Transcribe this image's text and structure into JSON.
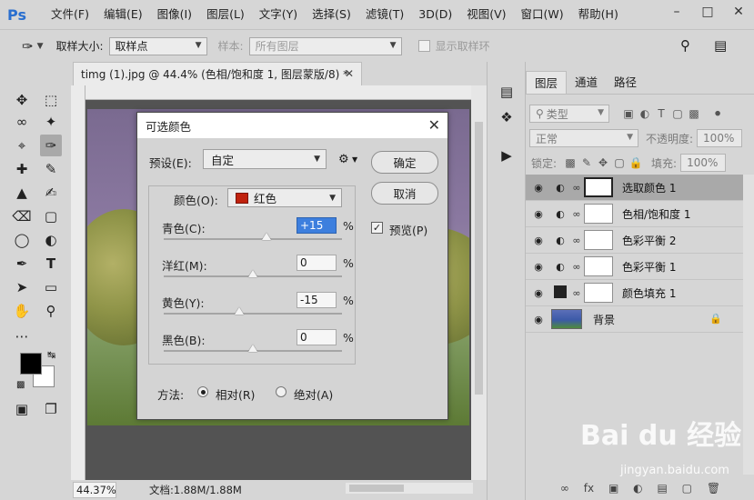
{
  "app": {
    "logo": "Ps"
  },
  "menu": [
    "文件(F)",
    "编辑(E)",
    "图像(I)",
    "图层(L)",
    "文字(Y)",
    "选择(S)",
    "滤镜(T)",
    "3D(D)",
    "视图(V)",
    "窗口(W)",
    "帮助(H)"
  ],
  "options": {
    "sample_size_label": "取样大小:",
    "sample_size_value": "取样点",
    "sample_label": "样本:",
    "sample_value": "所有图层",
    "show_ring_label": "显示取样环"
  },
  "document": {
    "tab_title": "timg (1).jpg @ 44.4% (色相/饱和度 1, 图层蒙版/8) *",
    "zoom": "44.37%",
    "doc_info": "文档:1.88M/1.88M"
  },
  "layers_panel": {
    "tabs": [
      "图层",
      "通道",
      "路径"
    ],
    "filter_type": "类型",
    "blend_mode": "正常",
    "opacity_label": "不透明度:",
    "opacity_value": "100%",
    "lock_label": "锁定:",
    "fill_label": "填充:",
    "fill_value": "100%",
    "layers": [
      {
        "name": "选取颜色 1",
        "selected": true
      },
      {
        "name": "色相/饱和度 1",
        "selected": false
      },
      {
        "name": "色彩平衡 2",
        "selected": false
      },
      {
        "name": "色彩平衡 1",
        "selected": false
      },
      {
        "name": "颜色填充 1",
        "selected": false
      },
      {
        "name": "背景",
        "selected": false
      }
    ]
  },
  "dialog": {
    "title": "可选颜色",
    "preset_label": "预设(E):",
    "preset_value": "自定",
    "ok_label": "确定",
    "cancel_label": "取消",
    "preview_label": "预览(P)",
    "colors_label": "颜色(O):",
    "colors_value": "红色",
    "sliders": [
      {
        "label": "青色(C):",
        "value": "+15",
        "level": 15
      },
      {
        "label": "洋红(M):",
        "value": "0",
        "level": 0
      },
      {
        "label": "黄色(Y):",
        "value": "-15",
        "level": -15
      },
      {
        "label": "黑色(B):",
        "value": "0",
        "level": 0
      }
    ],
    "percent": "%",
    "method_label": "方法:",
    "relative_label": "相对(R)",
    "absolute_label": "绝对(A)"
  },
  "watermark": {
    "brand": "Bai du 经验",
    "url": "jingyan.baidu.com"
  }
}
